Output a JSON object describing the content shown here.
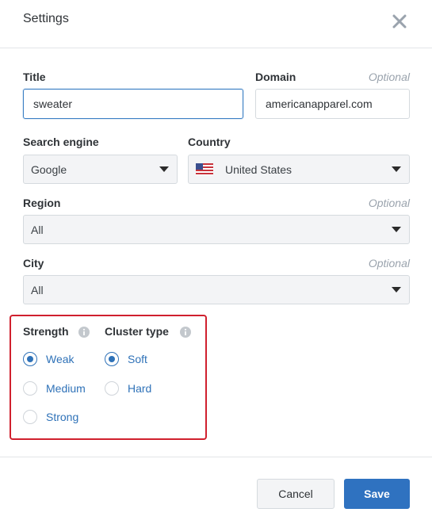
{
  "header": {
    "title": "Settings",
    "close_icon": "close-icon"
  },
  "form": {
    "title": {
      "label": "Title",
      "value": "sweater"
    },
    "domain": {
      "label": "Domain",
      "optional": "Optional",
      "value": "americanapparel.com"
    },
    "search_engine": {
      "label": "Search engine",
      "value": "Google"
    },
    "country": {
      "label": "Country",
      "value": "United States",
      "flag_icon": "us-flag-icon"
    },
    "region": {
      "label": "Region",
      "optional": "Optional",
      "value": "All"
    },
    "city": {
      "label": "City",
      "optional": "Optional",
      "value": "All"
    }
  },
  "strength": {
    "title": "Strength",
    "options": [
      {
        "label": "Weak",
        "checked": true
      },
      {
        "label": "Medium",
        "checked": false
      },
      {
        "label": "Strong",
        "checked": false
      }
    ]
  },
  "cluster_type": {
    "title": "Cluster type",
    "options": [
      {
        "label": "Soft",
        "checked": true
      },
      {
        "label": "Hard",
        "checked": false
      }
    ]
  },
  "footer": {
    "cancel_label": "Cancel",
    "save_label": "Save"
  },
  "colors": {
    "accent": "#2f72c0",
    "highlight_border": "#d0202e"
  }
}
